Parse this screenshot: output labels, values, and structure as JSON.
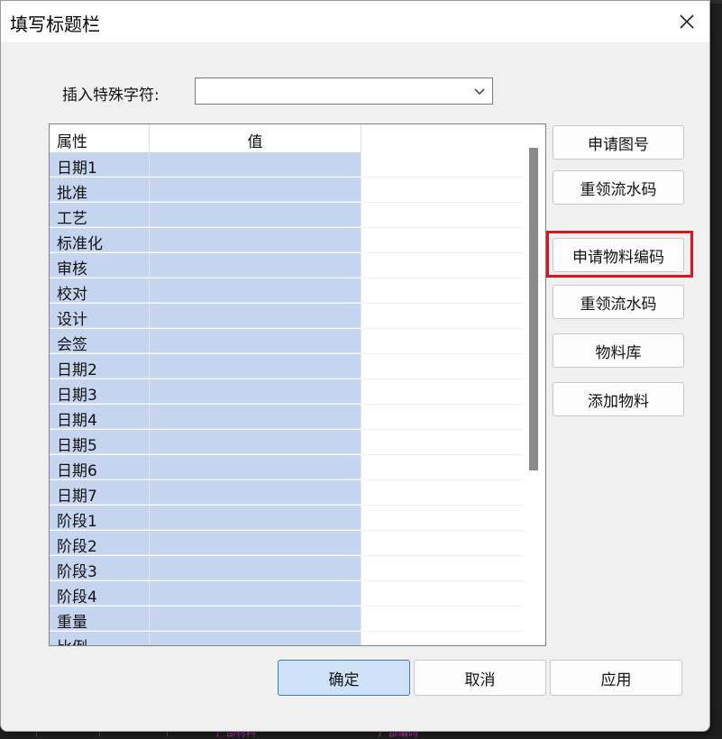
{
  "window": {
    "title": "填写标题栏"
  },
  "special_char": {
    "label": "插入特殊字符:",
    "value": ""
  },
  "grid": {
    "headers": [
      "属性",
      "值"
    ],
    "rows": [
      {
        "attr": "日期1",
        "value": ""
      },
      {
        "attr": "批准",
        "value": ""
      },
      {
        "attr": "工艺",
        "value": ""
      },
      {
        "attr": "标准化",
        "value": ""
      },
      {
        "attr": "审核",
        "value": ""
      },
      {
        "attr": "校对",
        "value": ""
      },
      {
        "attr": "设计",
        "value": ""
      },
      {
        "attr": "会签",
        "value": ""
      },
      {
        "attr": "日期2",
        "value": ""
      },
      {
        "attr": "日期3",
        "value": ""
      },
      {
        "attr": "日期4",
        "value": ""
      },
      {
        "attr": "日期5",
        "value": ""
      },
      {
        "attr": "日期6",
        "value": ""
      },
      {
        "attr": "日期7",
        "value": ""
      },
      {
        "attr": "阶段1",
        "value": ""
      },
      {
        "attr": "阶段2",
        "value": ""
      },
      {
        "attr": "阶段3",
        "value": ""
      },
      {
        "attr": "阶段4",
        "value": ""
      },
      {
        "attr": "重量",
        "value": ""
      },
      {
        "attr": "比例",
        "value": ""
      }
    ]
  },
  "side_buttons": {
    "apply_drawing_number": "申请图号",
    "reclaim_serial_1": "重领流水码",
    "apply_material_code": "申请物料编码",
    "reclaim_serial_2": "重领流水码",
    "material_library": "物料库",
    "add_material": "添加物料"
  },
  "footer": {
    "ok": "确定",
    "cancel": "取消",
    "apply": "应用"
  },
  "background": {
    "text_1": "广部材料",
    "text_2": "广部编码"
  },
  "colors": {
    "selection": "#c5d5f0",
    "highlight_box": "#e0121b",
    "primary_button": "#cde1f7"
  },
  "icons": {
    "close": "close-icon",
    "dropdown": "chevron-down-icon"
  }
}
